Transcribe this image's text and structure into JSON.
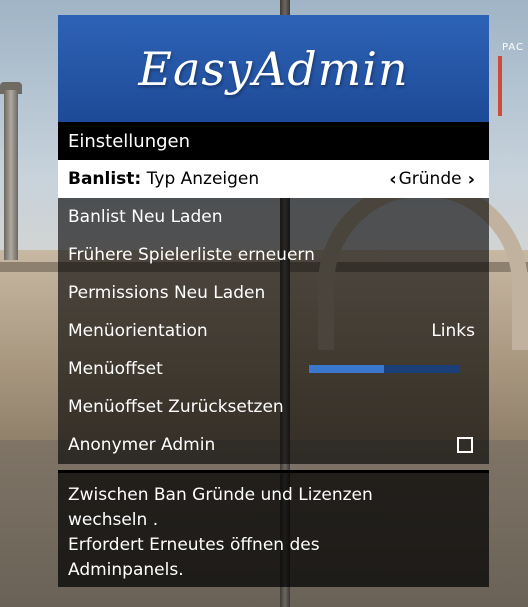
{
  "menu": {
    "banner_title": "EasyAdmin",
    "subtitle": "Einstellungen",
    "items": [
      {
        "prefix": "Banlist:",
        "label": "Typ Anzeigen",
        "value": "Gründe",
        "type": "list",
        "selected": true
      },
      {
        "label": "Banlist Neu Laden",
        "type": "button"
      },
      {
        "label": "Frühere Spielerliste erneuern",
        "type": "button"
      },
      {
        "label": "Permissions Neu Laden",
        "type": "button"
      },
      {
        "label": "Menüorientation",
        "value": "Links",
        "type": "list"
      },
      {
        "label": "Menüoffset",
        "type": "slider",
        "slider_level": 0.5
      },
      {
        "label": "Menüoffset Zurücksetzen",
        "type": "button"
      },
      {
        "label": "Anonymer Admin",
        "type": "checkbox",
        "checked": false
      }
    ],
    "description_lines": [
      "Zwischen Ban Gründe und Lizenzen",
      "wechseln .",
      "Erfordert Erneutes öffnen des",
      "Adminpanels."
    ]
  },
  "background": {
    "sign_text": "PAC"
  },
  "colors": {
    "banner": "#1e4a97",
    "slider_fill": "#3a78cf",
    "slider_track": "#1a3e76",
    "selected_bg": "#ffffff"
  },
  "icons": {
    "left_arrow": "chevron-left-icon",
    "right_arrow": "chevron-right-icon",
    "checkbox": "checkbox-icon"
  }
}
